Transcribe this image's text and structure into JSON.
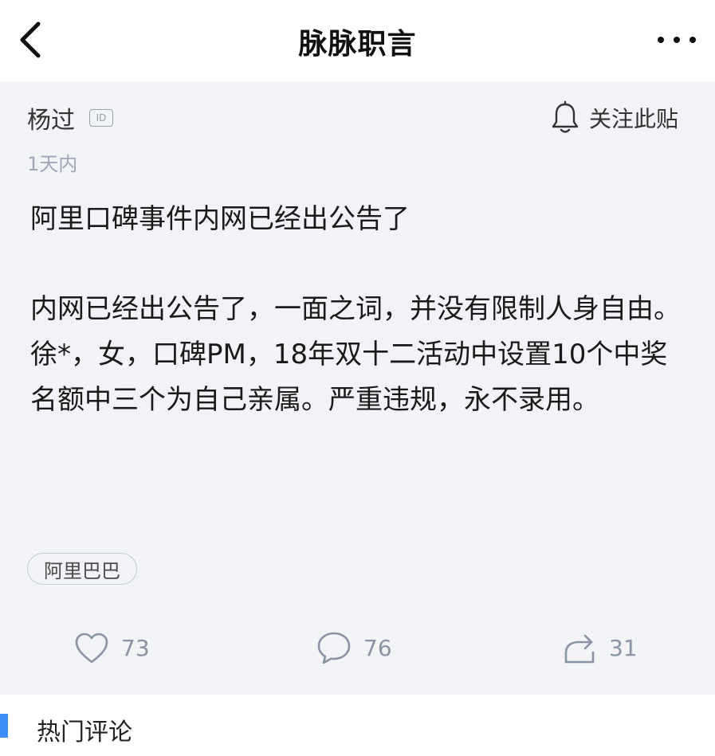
{
  "navbar": {
    "title": "脉脉职言",
    "back_icon": "chevron-left-icon",
    "more_icon": "more-dots-icon"
  },
  "post": {
    "author": "杨过",
    "id_badge": "ID",
    "time": "1天内",
    "follow_label": "关注此贴",
    "follow_icon": "bell-icon",
    "title": "阿里口碑事件内网已经出公告了",
    "content": "内网已经出公告了，一面之词，并没有限制人身自由。徐*，女，口碑PM，18年双十二活动中设置10个中奖名额中三个为自己亲属。严重违规，永不录用。",
    "tag": "阿里巴巴",
    "actions": {
      "likes": "73",
      "comments": "76",
      "shares": "31"
    }
  },
  "comments_section": {
    "title": "热门评论",
    "accent_color": "#3e8ef7"
  },
  "colors": {
    "post_background": "#f2f3f6",
    "muted_text": "#9ea6b8",
    "count_text": "#8a92a4"
  }
}
